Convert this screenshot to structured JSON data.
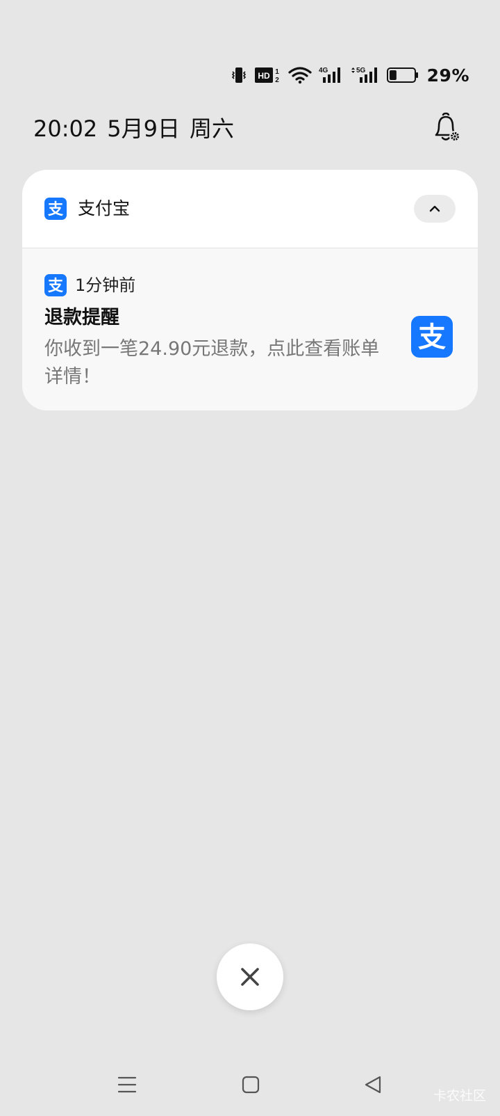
{
  "status_bar": {
    "icons": [
      "vibrate-icon",
      "hd-volte-icon",
      "wifi-icon",
      "signal-4g-icon",
      "signal-5g-icon",
      "battery-icon"
    ],
    "hd_label": "HD",
    "sim1": "1",
    "sim2": "2",
    "net1": "4G",
    "net2": "5G",
    "battery_percent": "29%",
    "battery_level": 0.29
  },
  "header": {
    "time": "20:02",
    "date": "5月9日",
    "weekday": "周六"
  },
  "notification": {
    "app_name": "支付宝",
    "icon_glyph": "支",
    "time_ago": "1分钟前",
    "title": "退款提醒",
    "text": "你收到一笔24.90元退款，点此查看账单详情！",
    "brand_color": "#1677ff"
  },
  "watermark": "卡农社区"
}
